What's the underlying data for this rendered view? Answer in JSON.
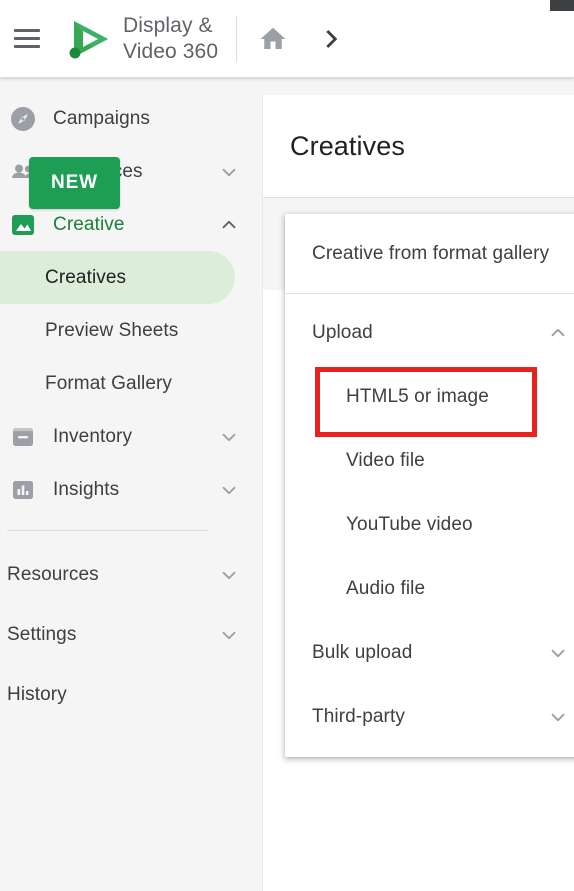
{
  "app": {
    "brand_name": "Display &\nVideo 360",
    "accent_green": "#1e9e54",
    "highlight_red": "#e8231f",
    "active_pill": "#dcedd9"
  },
  "header": {
    "menu_icon": "hamburger-icon",
    "logo_icon": "dv360-play-logo",
    "home_icon": "home-icon",
    "forward_icon": "chevron-right-icon"
  },
  "sidebar": {
    "items": [
      {
        "label": "Campaigns",
        "icon": "compass-icon",
        "caret": null,
        "active": false
      },
      {
        "label": "Audiences",
        "icon": "people-icon",
        "caret": "chevron-down-icon",
        "active": false
      },
      {
        "label": "Creative",
        "icon": "image-icon",
        "caret": "chevron-up-icon",
        "active": true
      }
    ],
    "creative_children": [
      {
        "label": "Creatives",
        "active": true
      },
      {
        "label": "Preview Sheets",
        "active": false
      },
      {
        "label": "Format Gallery",
        "active": false
      }
    ],
    "items_after": [
      {
        "label": "Inventory",
        "icon": "inventory-icon",
        "caret": "chevron-down-icon"
      },
      {
        "label": "Insights",
        "icon": "insights-icon",
        "caret": "chevron-down-icon"
      }
    ],
    "footer_items": [
      {
        "label": "Resources",
        "caret": "chevron-down-icon"
      },
      {
        "label": "Settings",
        "caret": "chevron-down-icon"
      },
      {
        "label": "History",
        "caret": null
      }
    ]
  },
  "main": {
    "page_title": "Creatives",
    "new_button_label": "NEW"
  },
  "dropdown": {
    "items": [
      {
        "label": "Creative from format gallery",
        "caret": null,
        "indent": false,
        "highlight": false
      },
      {
        "label": "Upload",
        "caret": "chevron-up-icon",
        "indent": false,
        "highlight": false
      },
      {
        "label": "HTML5 or image",
        "caret": null,
        "indent": true,
        "highlight": true
      },
      {
        "label": "Video file",
        "caret": null,
        "indent": true,
        "highlight": false
      },
      {
        "label": "YouTube video",
        "caret": null,
        "indent": true,
        "highlight": false
      },
      {
        "label": "Audio file",
        "caret": null,
        "indent": true,
        "highlight": false
      },
      {
        "label": "Bulk upload",
        "caret": "chevron-down-icon",
        "indent": false,
        "highlight": false
      },
      {
        "label": "Third-party",
        "caret": "chevron-down-icon",
        "indent": false,
        "highlight": false
      }
    ]
  }
}
